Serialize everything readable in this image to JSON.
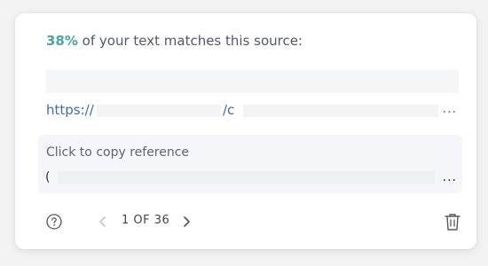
{
  "match": {
    "percent": "38%",
    "text": " of your text matches this source:"
  },
  "source": {
    "url_prefix": "https://",
    "url_mid": "/c",
    "more": "..."
  },
  "reference": {
    "label": "Click to copy reference",
    "paren": "(",
    "more": "..."
  },
  "pager": {
    "text": "1 OF 36"
  },
  "icons": {
    "help": "help-circle-icon",
    "prev": "chevron-left-icon",
    "next": "chevron-right-icon",
    "delete": "trash-icon"
  },
  "colors": {
    "accent": "#4aa3a4",
    "link": "#3b6fa6"
  }
}
